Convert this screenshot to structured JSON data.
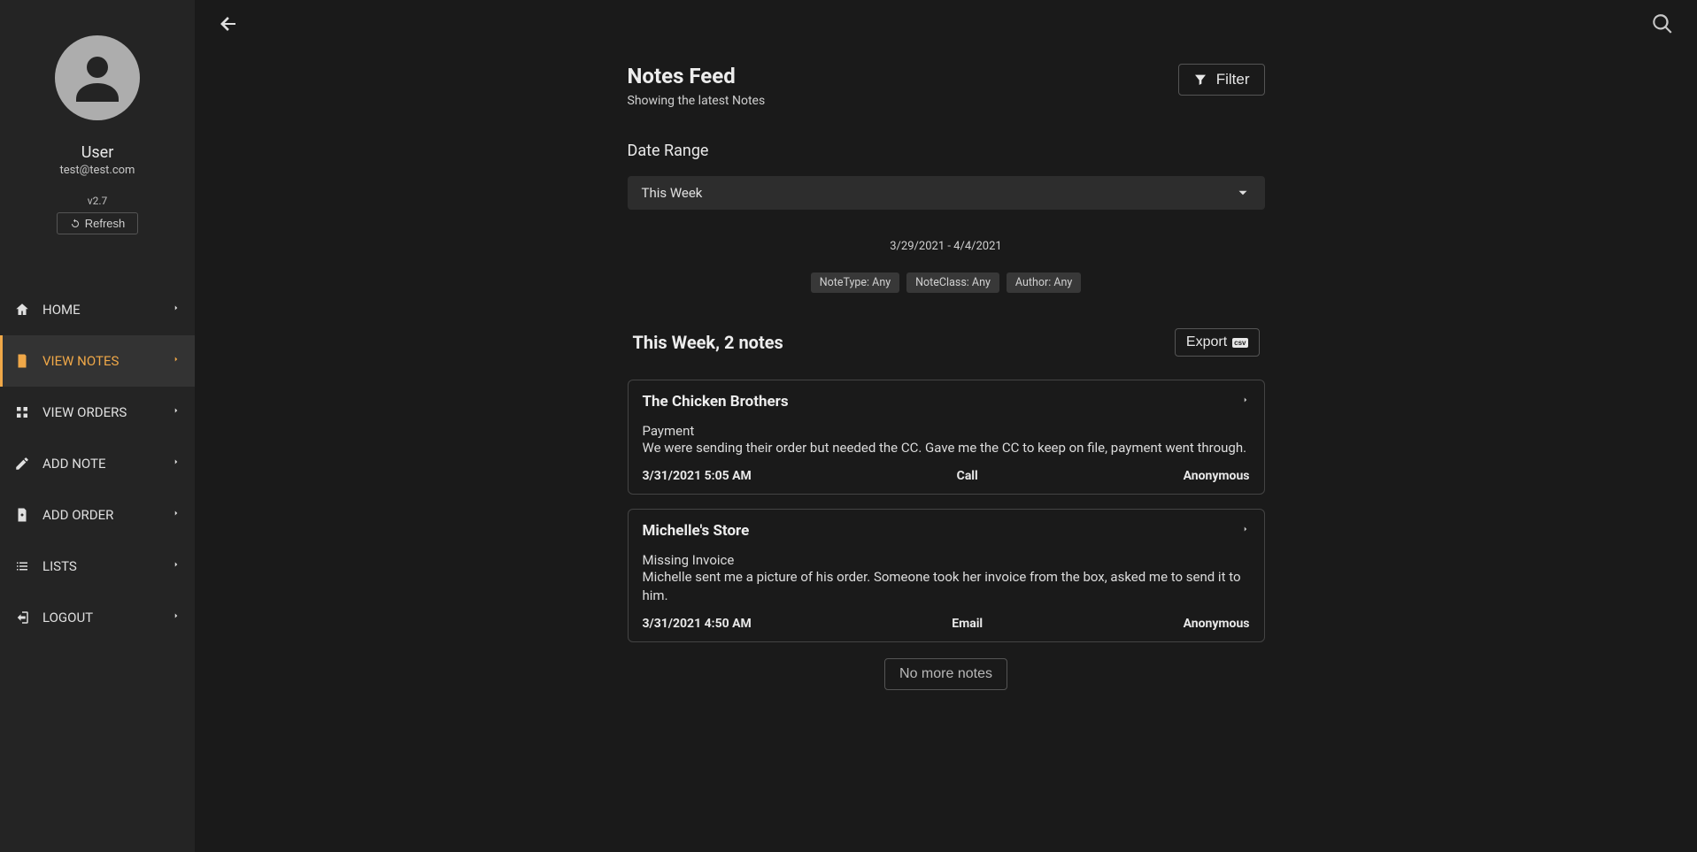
{
  "sidebar": {
    "username": "User",
    "email": "test@test.com",
    "version": "v2.7",
    "refresh_label": "Refresh",
    "items": [
      {
        "label": "HOME",
        "icon": "home-icon",
        "active": false
      },
      {
        "label": "VIEW NOTES",
        "icon": "notes-icon",
        "active": true
      },
      {
        "label": "VIEW ORDERS",
        "icon": "orders-icon",
        "active": false
      },
      {
        "label": "ADD NOTE",
        "icon": "add-note-icon",
        "active": false
      },
      {
        "label": "ADD ORDER",
        "icon": "add-order-icon",
        "active": false
      },
      {
        "label": "LISTS",
        "icon": "lists-icon",
        "active": false
      },
      {
        "label": "LOGOUT",
        "icon": "logout-icon",
        "active": false
      }
    ]
  },
  "header": {
    "title": "Notes Feed",
    "subtitle": "Showing the latest Notes",
    "filter_label": "Filter"
  },
  "date_section": {
    "label": "Date Range",
    "selected": "This Week",
    "range_text": "3/29/2021 - 4/4/2021"
  },
  "filters": [
    "NoteType: Any",
    "NoteClass: Any",
    "Author: Any"
  ],
  "results": {
    "title": "This Week, 2 notes",
    "export_label": "Export",
    "export_badge": "csv",
    "no_more_label": "No more notes"
  },
  "notes": [
    {
      "title": "The Chicken Brothers",
      "subtitle": "Payment",
      "body": "We were sending their order but needed the CC. Gave me the CC to keep on file, payment went through.",
      "date": "3/31/2021 5:05 AM",
      "type": "Call",
      "author": "Anonymous"
    },
    {
      "title": "Michelle's Store",
      "subtitle": "Missing Invoice",
      "body": "Michelle sent me a picture of his order. Someone took her invoice from the box, asked me to send it to him.",
      "date": "3/31/2021 4:50 AM",
      "type": "Email",
      "author": "Anonymous"
    }
  ]
}
